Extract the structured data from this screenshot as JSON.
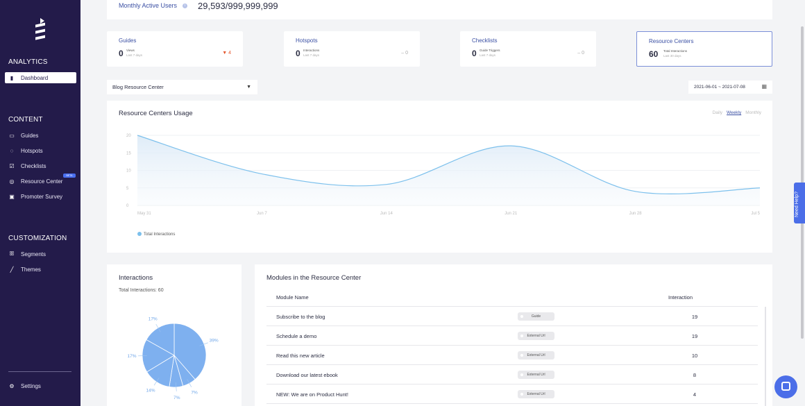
{
  "sidebar": {
    "sections": {
      "analytics": "ANALYTICS",
      "content": "CONTENT",
      "customization": "CUSTOMIZATION"
    },
    "items": {
      "dashboard": "Dashboard",
      "guides": "Guides",
      "hotspots": "Hotspots",
      "checklists": "Checklists",
      "resource_center": "Resource Center",
      "promoter_survey": "Promoter Survey",
      "segments": "Segments",
      "themes": "Themes",
      "settings": "Settings"
    },
    "beta_badge": "BETA"
  },
  "top": {
    "mau_label": "Monthly Active Users",
    "mau_value": "29,593/999,999,999"
  },
  "stats": [
    {
      "title": "Guides",
      "value": "0",
      "unit": "Views",
      "period": "Last 7 days",
      "trend": "▼ 4"
    },
    {
      "title": "Hotspots",
      "value": "0",
      "unit": "Interactions",
      "period": "Last 7 days",
      "trend": "– 0"
    },
    {
      "title": "Checklists",
      "value": "0",
      "unit": "Guide Triggers",
      "period": "Last 7 days",
      "trend": "– 0"
    },
    {
      "title": "Resource Centers",
      "value": "60",
      "unit": "Total Interactions",
      "period": "Last 30 days"
    }
  ],
  "filters": {
    "resource_center": "Blog Resource Center",
    "date_range": "2021-06-01 ~ 2021-07-08"
  },
  "usage": {
    "title": "Resource Centers Usage",
    "tabs": [
      "Daily",
      "Weekly",
      "Monthly"
    ],
    "active_tab": "Weekly"
  },
  "chart_data": [
    {
      "type": "area",
      "title": "Resource Centers Usage",
      "x": [
        "May 31",
        "Jun 7",
        "Jun 14",
        "Jun 21",
        "Jun 28",
        "Jul 5"
      ],
      "series": [
        {
          "name": "Total Interactions",
          "values": [
            20,
            9,
            6,
            17,
            4,
            5
          ]
        }
      ],
      "yticks": [
        0,
        5,
        10,
        15,
        20
      ],
      "ylim": [
        0,
        20
      ],
      "grid": true,
      "legend": "bottom-left",
      "color": "#7cc0ec"
    },
    {
      "type": "pie",
      "labels": [
        "39%",
        "7%",
        "7%",
        "14%",
        "17%",
        "17%"
      ],
      "values": [
        39,
        7,
        7,
        14,
        17,
        17
      ],
      "color": "#7eb0ef"
    }
  ],
  "interactions": {
    "title": "Interactions",
    "total": "Total Interactions: 60"
  },
  "modules": {
    "title": "Modules in the Resource Center",
    "headers": [
      "Module Name",
      "Interaction"
    ],
    "rows": [
      {
        "name": "Subscribe to the blog",
        "type": "Guide",
        "count": "19"
      },
      {
        "name": "Schedule a demo",
        "type": "External Url",
        "count": "19"
      },
      {
        "name": "Read this new article",
        "type": "External Url",
        "count": "10"
      },
      {
        "name": "Download our latest ebook",
        "type": "External Url",
        "count": "8"
      },
      {
        "name": "NEW: We are on Product Hunt!",
        "type": "External Url",
        "count": "4"
      }
    ]
  },
  "help": {
    "need_help": "Need Help?"
  }
}
